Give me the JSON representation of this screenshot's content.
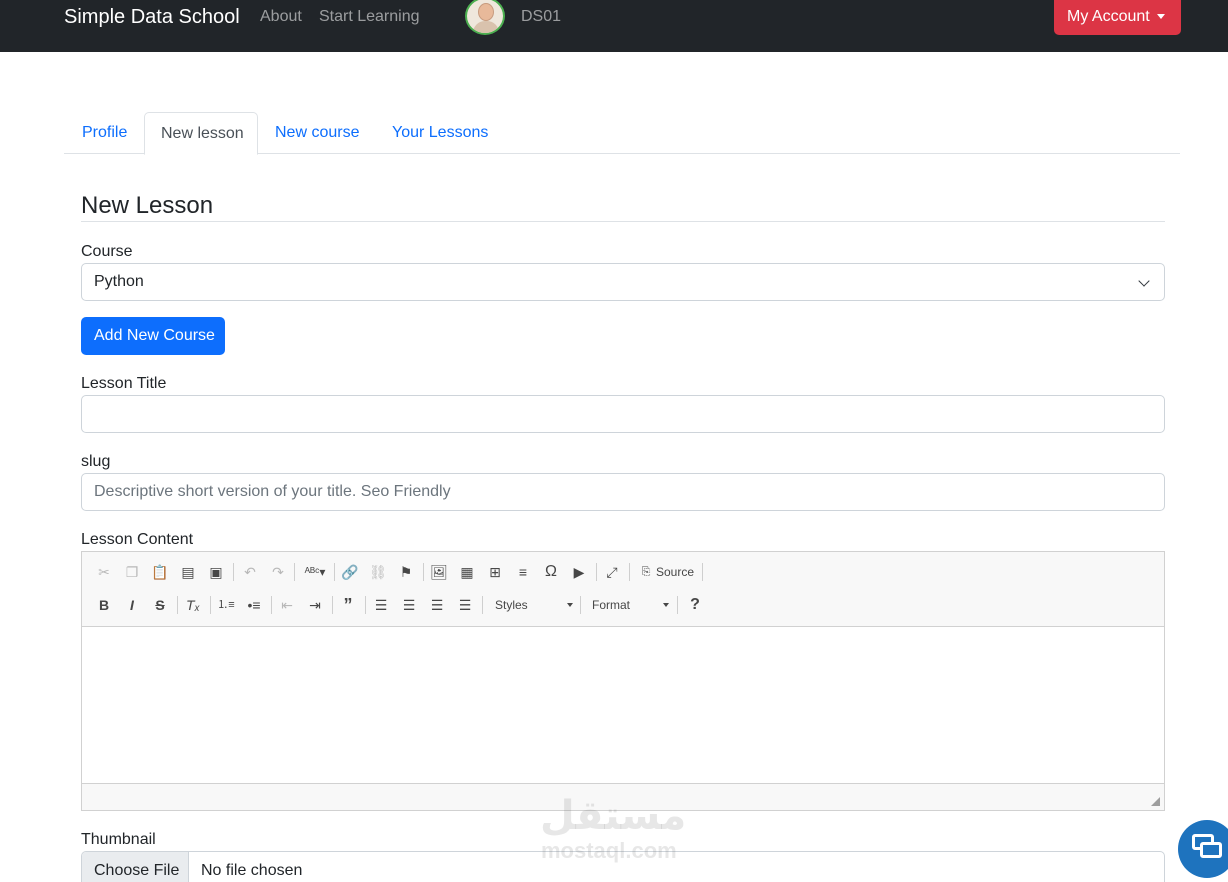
{
  "navbar": {
    "brand": "Simple Data School",
    "links": [
      "About",
      "Start Learning"
    ],
    "username": "DS01",
    "account_label": "My Account"
  },
  "tabs": [
    "Profile",
    "New lesson",
    "New course",
    "Your Lessons"
  ],
  "form": {
    "legend": "New Lesson",
    "course_label": "Course",
    "course_selected": "Python",
    "add_course_label": "Add New Course",
    "title_label": "Lesson Title",
    "title_value": "",
    "slug_label": "slug",
    "slug_placeholder": "Descriptive short version of your title. Seo Friendly",
    "content_label": "Lesson Content",
    "thumbnail_label": "Thumbnail",
    "file_button": "Choose File",
    "file_status": "No file chosen"
  },
  "editor": {
    "source_label": "Source",
    "styles_label": "Styles",
    "format_label": "Format",
    "icons_row1": [
      "cut-icon",
      "copy-icon",
      "paste-icon",
      "paste-text-icon",
      "paste-word-icon",
      "undo-icon",
      "redo-icon",
      "spellcheck-icon",
      "link-icon",
      "unlink-icon",
      "anchor-icon",
      "image-icon",
      "flash-icon",
      "table-icon",
      "horizontal-rule-icon",
      "special-char-icon",
      "youtube-icon",
      "maximize-icon",
      "source-icon"
    ],
    "icons_row2": [
      "bold-icon",
      "italic-icon",
      "strike-icon",
      "remove-format-icon",
      "numbered-list-icon",
      "bulleted-list-icon",
      "outdent-icon",
      "indent-icon",
      "blockquote-icon",
      "align-left-icon",
      "align-center-icon",
      "align-right-icon",
      "justify-icon",
      "help-icon"
    ]
  },
  "watermark": {
    "arabic": "مستقل",
    "latin": "mostaql.com"
  },
  "colors": {
    "navbar": "#212529",
    "account": "#dc3545",
    "primary": "#0d6efd",
    "chat": "#1e73be"
  }
}
